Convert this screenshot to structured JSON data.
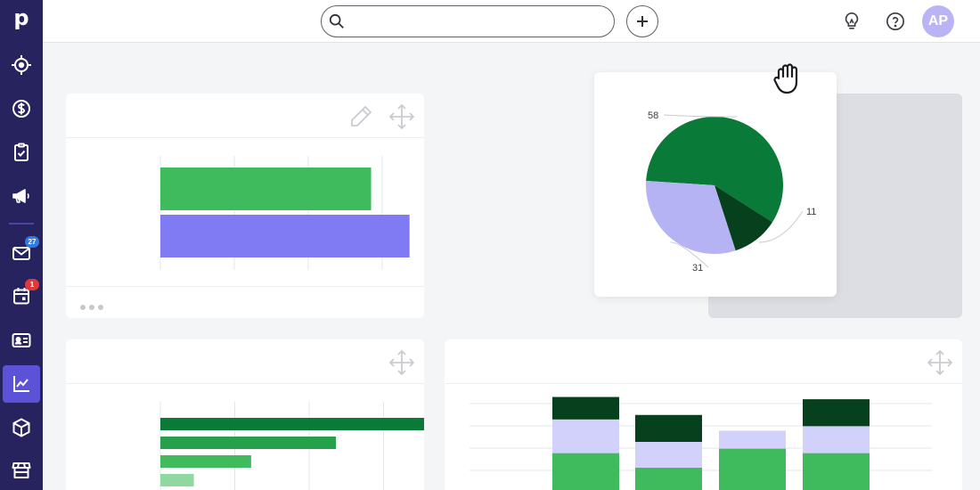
{
  "sidebar": {
    "logo": "p",
    "items": [
      {
        "name": "deals",
        "icon": "target-icon"
      },
      {
        "name": "revenue",
        "icon": "dollar-icon"
      },
      {
        "name": "tasks",
        "icon": "clipboard-check-icon"
      },
      {
        "name": "campaigns",
        "icon": "megaphone-icon"
      },
      {
        "name": "mail",
        "icon": "mail-icon",
        "badge": "27"
      },
      {
        "name": "calendar",
        "icon": "calendar-icon",
        "badge": "1"
      },
      {
        "name": "contacts",
        "icon": "contact-card-icon"
      },
      {
        "name": "insights",
        "icon": "chart-icon",
        "active": true
      },
      {
        "name": "products",
        "icon": "box-icon"
      },
      {
        "name": "marketplace",
        "icon": "store-icon"
      }
    ]
  },
  "topbar": {
    "search_placeholder": "",
    "avatar_initials": "AP"
  },
  "colors": {
    "sidebar_bg": "#26235e",
    "active_bg": "#5c52d8",
    "green_light": "#3fbb5d",
    "purple": "#817bf3",
    "green_dark": "#097a38",
    "green_darker": "#07401c",
    "lavender": "#b6b3f4",
    "lavender_light": "#d2d1fb"
  },
  "widgets": {
    "bar_top": {
      "chart_data": {
        "type": "bar",
        "orientation": "horizontal",
        "values": [
          285,
          337
        ],
        "colors": [
          "#3fbb5d",
          "#817bf3"
        ],
        "xlim": [
          0,
          400
        ],
        "grid": true
      }
    },
    "pie": {
      "chart_data": {
        "type": "pie",
        "values": [
          58,
          11,
          31
        ],
        "labels": [
          "58",
          "11",
          "31"
        ],
        "colors": [
          "#097a38",
          "#07401c",
          "#b6b3f4"
        ]
      }
    },
    "bar_bottom": {
      "chart_data": {
        "type": "bar",
        "orientation": "horizontal",
        "values": [
          400,
          236,
          122,
          45
        ],
        "colors": [
          "#097a38",
          "#27a04c",
          "#3fbb5d",
          "#8fd8a0"
        ],
        "xlim": [
          0,
          400
        ],
        "grid": true
      }
    },
    "stacked": {
      "chart_data": {
        "type": "bar",
        "stacked": true,
        "series": [
          {
            "values": [
              40,
              27,
              44,
              40
            ],
            "color": "#3fbb5d"
          },
          {
            "values": [
              30,
              23,
              16,
              24
            ],
            "color": "#d2d1fb"
          },
          {
            "values": [
              20,
              24,
              0,
              24
            ],
            "color": "#07401c"
          }
        ],
        "ylim": [
          0,
          100
        ],
        "grid": true
      }
    }
  }
}
